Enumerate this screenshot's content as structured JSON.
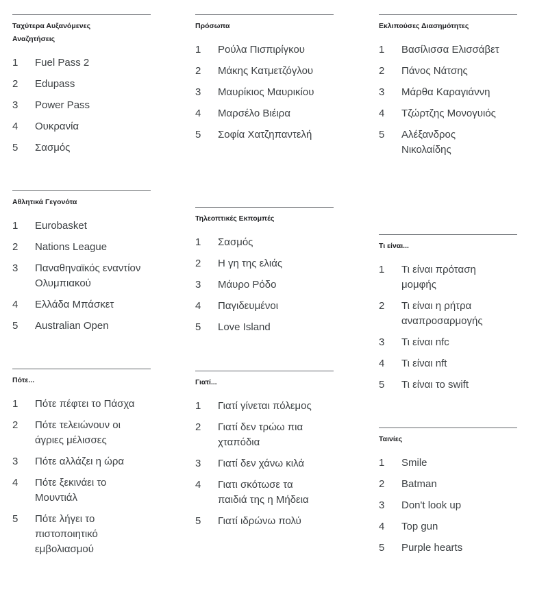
{
  "columns": [
    [
      {
        "title": "Ταχύτερα Αυξανόμενες Αναζητήσεις",
        "items": [
          "Fuel Pass 2",
          "Edupass",
          "Power Pass",
          "Ουκρανία",
          "Σασμός"
        ]
      },
      {
        "title": "Αθλητικά Γεγονότα",
        "items": [
          "Eurobasket",
          "Nations League",
          "Παναθηναϊκός εναντίον Ολυμπιακού",
          "Ελλάδα Μπάσκετ",
          "Australian Open"
        ]
      },
      {
        "title": "Πότε...",
        "items": [
          "Πότε πέφτει το Πάσχα",
          "Πότε τελειώνουν οι άγριες μέλισσες",
          "Πότε αλλάζει η ώρα",
          "Πότε ξεκινάει το Μουντιάλ",
          "Πότε λήγει το πιστοποιητικό εμβολιασμού"
        ]
      }
    ],
    [
      {
        "title": "Πρόσωπα",
        "items": [
          "Ρούλα Πισπιρίγκου",
          "Μάκης Κατμετζόγλου",
          "Μαυρίκιος Μαυρικίου",
          "Μαρσέλο Βιέιρα",
          "Σοφία Χατζηπαντελή"
        ]
      },
      {
        "title": "Τηλεοπτικές Εκπομπές",
        "items": [
          "Σασμός",
          "Η γη της ελιάς",
          "Μάυρο Ρόδο",
          "Παγιδευμένοι",
          "Love Island"
        ]
      },
      {
        "title": "Γιατί...",
        "items": [
          "Γιατί γίνεται πόλεμος",
          "Γιατί δεν τρώω πια χταπόδια",
          "Γιατί δεν χάνω κιλά",
          "Γιατι σκότωσε τα παιδιά της η Μήδεια",
          "Γιατί ιδρώνω πολύ"
        ]
      }
    ],
    [
      {
        "title": "Εκλιπούσες Διασημότητες",
        "items": [
          "Βασίλισσα Ελισσάβετ",
          "Πάνος Νάτσης",
          "Μάρθα Καραγιάννη",
          "Τζώρτζης Μονογυιός",
          "Αλέξανδρος Νικολαίδης"
        ]
      },
      {
        "title": "Τι είναι...",
        "items": [
          "Τι είναι πρόταση μομφής",
          "Τι είναι η ρήτρα αναπροσαρμογής",
          "Τι είναι nfc",
          "Τι είναι nft",
          "Τι είναι το swift"
        ]
      },
      {
        "title": "Ταινίες",
        "items": [
          "Smile",
          "Batman",
          "Don't look up",
          "Top gun",
          "Purple hearts"
        ]
      }
    ]
  ]
}
